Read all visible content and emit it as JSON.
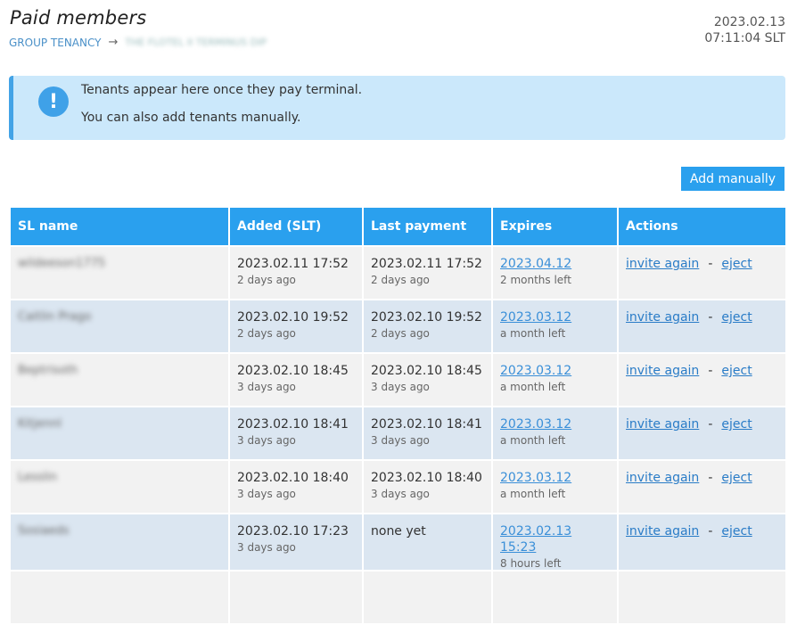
{
  "header": {
    "title": "Paid members",
    "breadcrumb_root": "GROUP TENANCY",
    "breadcrumb_arrow": "→",
    "breadcrumb_current": "THE FLOTEL II TERMINUS DIP",
    "clock_date": "2023.02.13",
    "clock_time": "07:11:04 SLT"
  },
  "notice": {
    "icon": "exclamation-icon",
    "line1": "Tenants appear here once they pay terminal.",
    "line2": "You can also add tenants manually."
  },
  "toolbar": {
    "add_label": "Add manually"
  },
  "table": {
    "columns": [
      "SL name",
      "Added (SLT)",
      "Last payment",
      "Expires",
      "Actions"
    ],
    "action_invite": "invite again",
    "action_separator": "-",
    "action_eject": "eject",
    "rows": [
      {
        "name": "wildeeson1775",
        "added": "2023.02.11 17:52",
        "added_ago": "2 days ago",
        "payment": "2023.02.11 17:52",
        "payment_ago": "2 days ago",
        "expires": "2023.04.12",
        "expires_left": "2 months left"
      },
      {
        "name": "Caitlin Prago",
        "added": "2023.02.10 19:52",
        "added_ago": "2 days ago",
        "payment": "2023.02.10 19:52",
        "payment_ago": "2 days ago",
        "expires": "2023.03.12",
        "expires_left": "a month left"
      },
      {
        "name": "Beptrisoth",
        "added": "2023.02.10 18:45",
        "added_ago": "3 days ago",
        "payment": "2023.02.10 18:45",
        "payment_ago": "3 days ago",
        "expires": "2023.03.12",
        "expires_left": "a month left"
      },
      {
        "name": "Kitjennl",
        "added": "2023.02.10 18:41",
        "added_ago": "3 days ago",
        "payment": "2023.02.10 18:41",
        "payment_ago": "3 days ago",
        "expires": "2023.03.12",
        "expires_left": "a month left"
      },
      {
        "name": "Lesslin",
        "added": "2023.02.10 18:40",
        "added_ago": "3 days ago",
        "payment": "2023.02.10 18:40",
        "payment_ago": "3 days ago",
        "expires": "2023.03.12",
        "expires_left": "a month left"
      },
      {
        "name": "Sosiaeds",
        "added": "2023.02.10 17:23",
        "added_ago": "3 days ago",
        "payment": "none yet",
        "payment_ago": "",
        "expires": "2023.02.13 15:23",
        "expires_left": "8 hours left"
      }
    ]
  }
}
